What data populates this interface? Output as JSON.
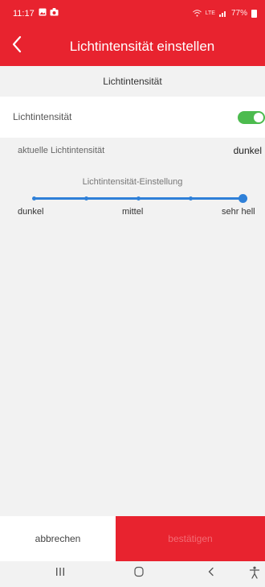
{
  "colors": {
    "accent": "#e8232f",
    "slider": "#2f80d8",
    "toggle_on": "#4cbb4e"
  },
  "status_bar": {
    "time": "11:17",
    "signal_text": "LTE",
    "battery": "77%"
  },
  "header": {
    "title": "Lichtintensität einstellen",
    "back_icon": "chevron-left-icon"
  },
  "section": {
    "title": "Lichtintensität"
  },
  "toggle_row": {
    "label": "Lichtintensität",
    "enabled": true
  },
  "current": {
    "label": "aktuelle Lichtintensität",
    "value": "dunkel"
  },
  "setting": {
    "title": "Lichtintensität-Einstellung",
    "steps": 5,
    "selected_index": 4,
    "labels": {
      "low": "dunkel",
      "mid": "mittel",
      "high": "sehr hell"
    }
  },
  "actions": {
    "cancel": "abbrechen",
    "confirm": "bestätigen"
  },
  "nav": {
    "recent_icon": "recent-apps-icon",
    "home_icon": "home-icon",
    "back_icon": "back-icon",
    "accessibility_icon": "accessibility-icon"
  }
}
